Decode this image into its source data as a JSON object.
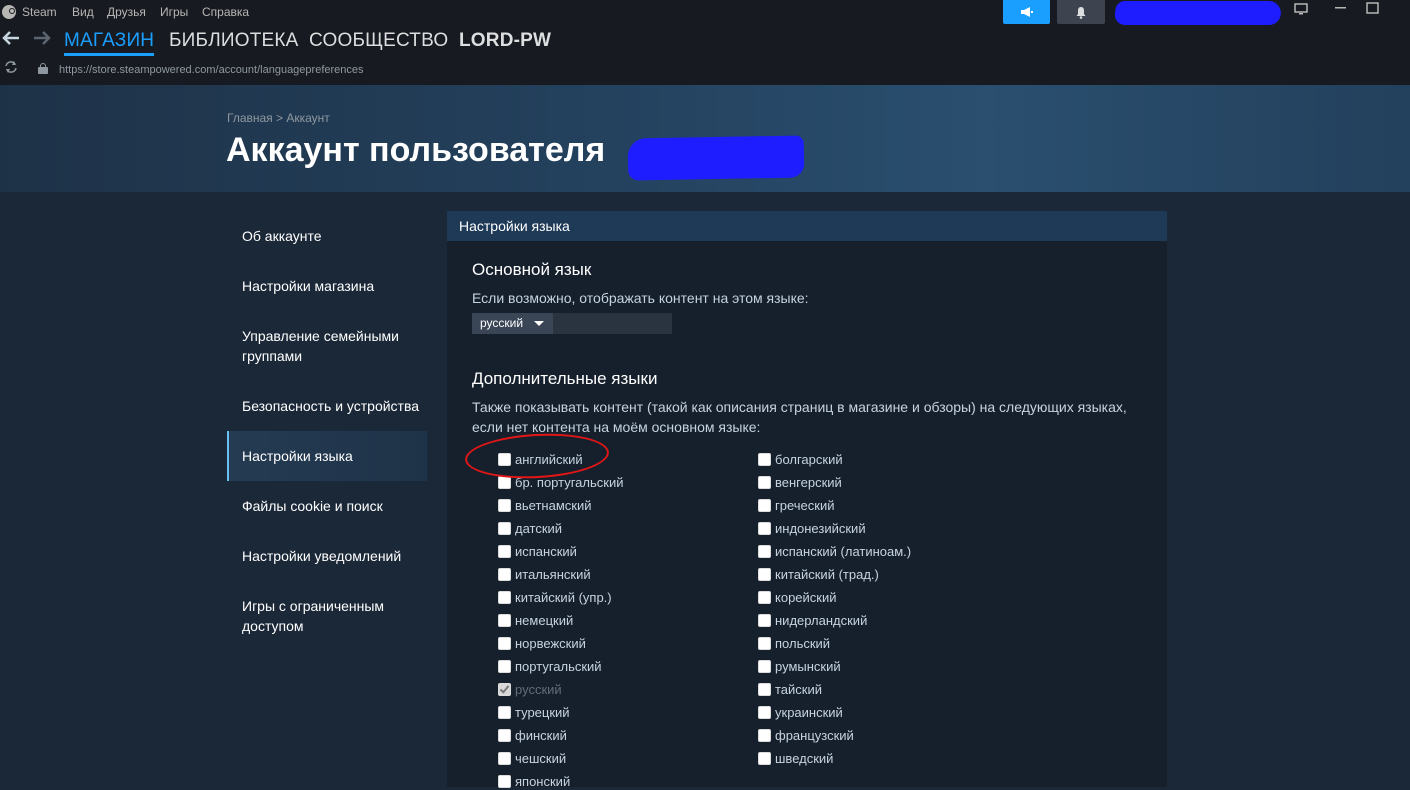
{
  "menubar": {
    "app_name": "Steam",
    "items": [
      "Вид",
      "Друзья",
      "Игры",
      "Справка"
    ]
  },
  "nav": {
    "tabs": [
      "МАГАЗИН",
      "БИБЛИОТЕКА",
      "СООБЩЕСТВО",
      "LORD-PW"
    ],
    "active_tab": "МАГАЗИН",
    "url": "https://store.steampowered.com/account/languagepreferences"
  },
  "header": {
    "breadcrumb": "Главная > Аккаунт",
    "title": "Аккаунт пользователя"
  },
  "sidebar": {
    "items": [
      {
        "label": "Об аккаунте"
      },
      {
        "label": "Настройки магазина"
      },
      {
        "label": "Управление семейными группами"
      },
      {
        "label": "Безопасность и устройства"
      },
      {
        "label": "Настройки языка"
      },
      {
        "label": "Файлы cookie и поиск"
      },
      {
        "label": "Настройки уведомлений"
      },
      {
        "label": "Игры с ограниченным доступом"
      }
    ],
    "active": "Настройки языка"
  },
  "panel": {
    "heading": "Настройки языка",
    "primary": {
      "title": "Основной язык",
      "description": "Если возможно, отображать контент на этом языке:",
      "selected": "русский"
    },
    "additional": {
      "title": "Дополнительные языки",
      "description": "Также показывать контент (такой как описания страниц в магазине и обзоры) на следующих языках, если нет контента на моём основном языке:",
      "left_column": [
        {
          "label": "английский",
          "checked": false
        },
        {
          "label": "бр. португальский",
          "checked": false
        },
        {
          "label": "вьетнамский",
          "checked": false
        },
        {
          "label": "датский",
          "checked": false
        },
        {
          "label": "испанский",
          "checked": false
        },
        {
          "label": "итальянский",
          "checked": false
        },
        {
          "label": "китайский (упр.)",
          "checked": false
        },
        {
          "label": "немецкий",
          "checked": false
        },
        {
          "label": "норвежский",
          "checked": false
        },
        {
          "label": "португальский",
          "checked": false
        },
        {
          "label": "русский",
          "checked": true,
          "disabled": true
        },
        {
          "label": "турецкий",
          "checked": false
        },
        {
          "label": "финский",
          "checked": false
        },
        {
          "label": "чешский",
          "checked": false
        },
        {
          "label": "японский",
          "checked": false
        }
      ],
      "right_column": [
        {
          "label": "болгарский",
          "checked": false
        },
        {
          "label": "венгерский",
          "checked": false
        },
        {
          "label": "греческий",
          "checked": false
        },
        {
          "label": "индонезийский",
          "checked": false
        },
        {
          "label": "испанский (латиноам.)",
          "checked": false
        },
        {
          "label": "китайский (трад.)",
          "checked": false
        },
        {
          "label": "корейский",
          "checked": false
        },
        {
          "label": "нидерландский",
          "checked": false
        },
        {
          "label": "польский",
          "checked": false
        },
        {
          "label": "румынский",
          "checked": false
        },
        {
          "label": "тайский",
          "checked": false
        },
        {
          "label": "украинский",
          "checked": false
        },
        {
          "label": "французский",
          "checked": false
        },
        {
          "label": "шведский",
          "checked": false
        }
      ]
    }
  },
  "colors": {
    "accent": "#1a9fff",
    "background": "#1b2838",
    "panel": "#16202d",
    "annotation": "#e11616",
    "redaction": "#1d1dff"
  },
  "icons": [
    "steam-logo-icon",
    "announcement-icon",
    "bell-icon",
    "back-arrow-icon",
    "forward-arrow-icon",
    "reload-icon",
    "lock-icon",
    "big-picture-icon",
    "maximize-icon",
    "dropdown-caret-icon"
  ]
}
